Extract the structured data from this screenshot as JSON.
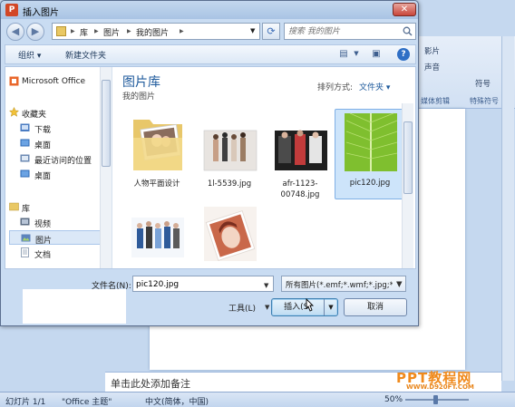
{
  "dialog": {
    "title": "插入图片",
    "close_label": "✕",
    "address": {
      "root": "库",
      "level1": "图片",
      "level2": "我的图片",
      "sep": "▶"
    },
    "search": {
      "placeholder": "搜索 我的图片"
    },
    "toolbar": {
      "organize": "组织 ▾",
      "new_folder": "新建文件夹"
    },
    "sidebar": {
      "microsoft_office": "Microsoft Office",
      "favorites_header": "收藏夹",
      "favorites": [
        "下载",
        "桌面",
        "最近访问的位置",
        "桌面"
      ],
      "libraries_header": "库",
      "libraries": [
        "视频",
        "图片",
        "文档"
      ]
    },
    "main": {
      "header": "图片库",
      "subheader": "我的图片",
      "sort_label": "排列方式:",
      "sort_value": "文件夹 ▾",
      "files": [
        {
          "name": "人物平面设计",
          "kind": "folder"
        },
        {
          "name": "1l-5539.jpg",
          "kind": "image"
        },
        {
          "name": "afr-1123-00748.jpg",
          "kind": "image"
        },
        {
          "name": "pic120.jpg",
          "kind": "image",
          "selected": true
        },
        {
          "name": "",
          "kind": "image"
        },
        {
          "name": "",
          "kind": "image"
        }
      ]
    },
    "bottom": {
      "filename_label": "文件名(N):",
      "filename_value": "pic120.jpg",
      "filetype_value": "所有图片(*.emf;*.wmf;*.jpg;*.jp",
      "tools_label": "工具(L)",
      "insert_label": "插入(S)",
      "cancel_label": "取消"
    }
  },
  "powerpoint": {
    "ribbon": {
      "movie": "影片",
      "sound": "声音",
      "symbol": "符号",
      "media_group": "媒体剪辑",
      "special_group": "特殊符号"
    },
    "notes_placeholder": "单击此处添加备注",
    "status": {
      "slide": "幻灯片 1/1",
      "theme": "\"Office 主题\"",
      "language": "中文(简体，中国)",
      "zoom": "50%"
    },
    "watermark": "PPT教程网",
    "watermark_url": "WWW.D920FT.COM"
  },
  "colors": {
    "accent": "#1e5a9c",
    "close": "#c9453a",
    "titlebar": "#a9c4e4"
  }
}
